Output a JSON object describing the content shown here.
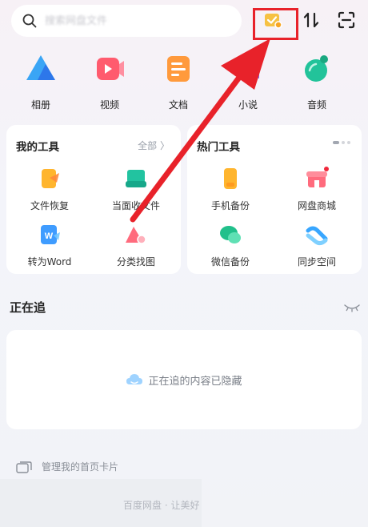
{
  "search": {
    "placeholder": "搜索网盘文件"
  },
  "media": [
    {
      "label": "相册"
    },
    {
      "label": "视频"
    },
    {
      "label": "文档"
    },
    {
      "label": "小说"
    },
    {
      "label": "音频"
    }
  ],
  "my_tools": {
    "title": "我的工具",
    "more": "全部 〉",
    "items": [
      {
        "label": "文件恢复"
      },
      {
        "label": "当面收文件"
      },
      {
        "label": "转为Word"
      },
      {
        "label": "分类找图"
      }
    ]
  },
  "hot_tools": {
    "title": "热门工具",
    "items": [
      {
        "label": "手机备份"
      },
      {
        "label": "网盘商城"
      },
      {
        "label": "微信备份"
      },
      {
        "label": "同步空间"
      }
    ]
  },
  "following": {
    "title": "正在追",
    "hidden_text": "正在追的内容已隐藏"
  },
  "manage": {
    "label": "管理我的首页卡片"
  },
  "footer": {
    "text": "百度网盘 · 让美好"
  },
  "colors": {
    "annotation": "#e8222a",
    "accent": "#3b8cff"
  }
}
